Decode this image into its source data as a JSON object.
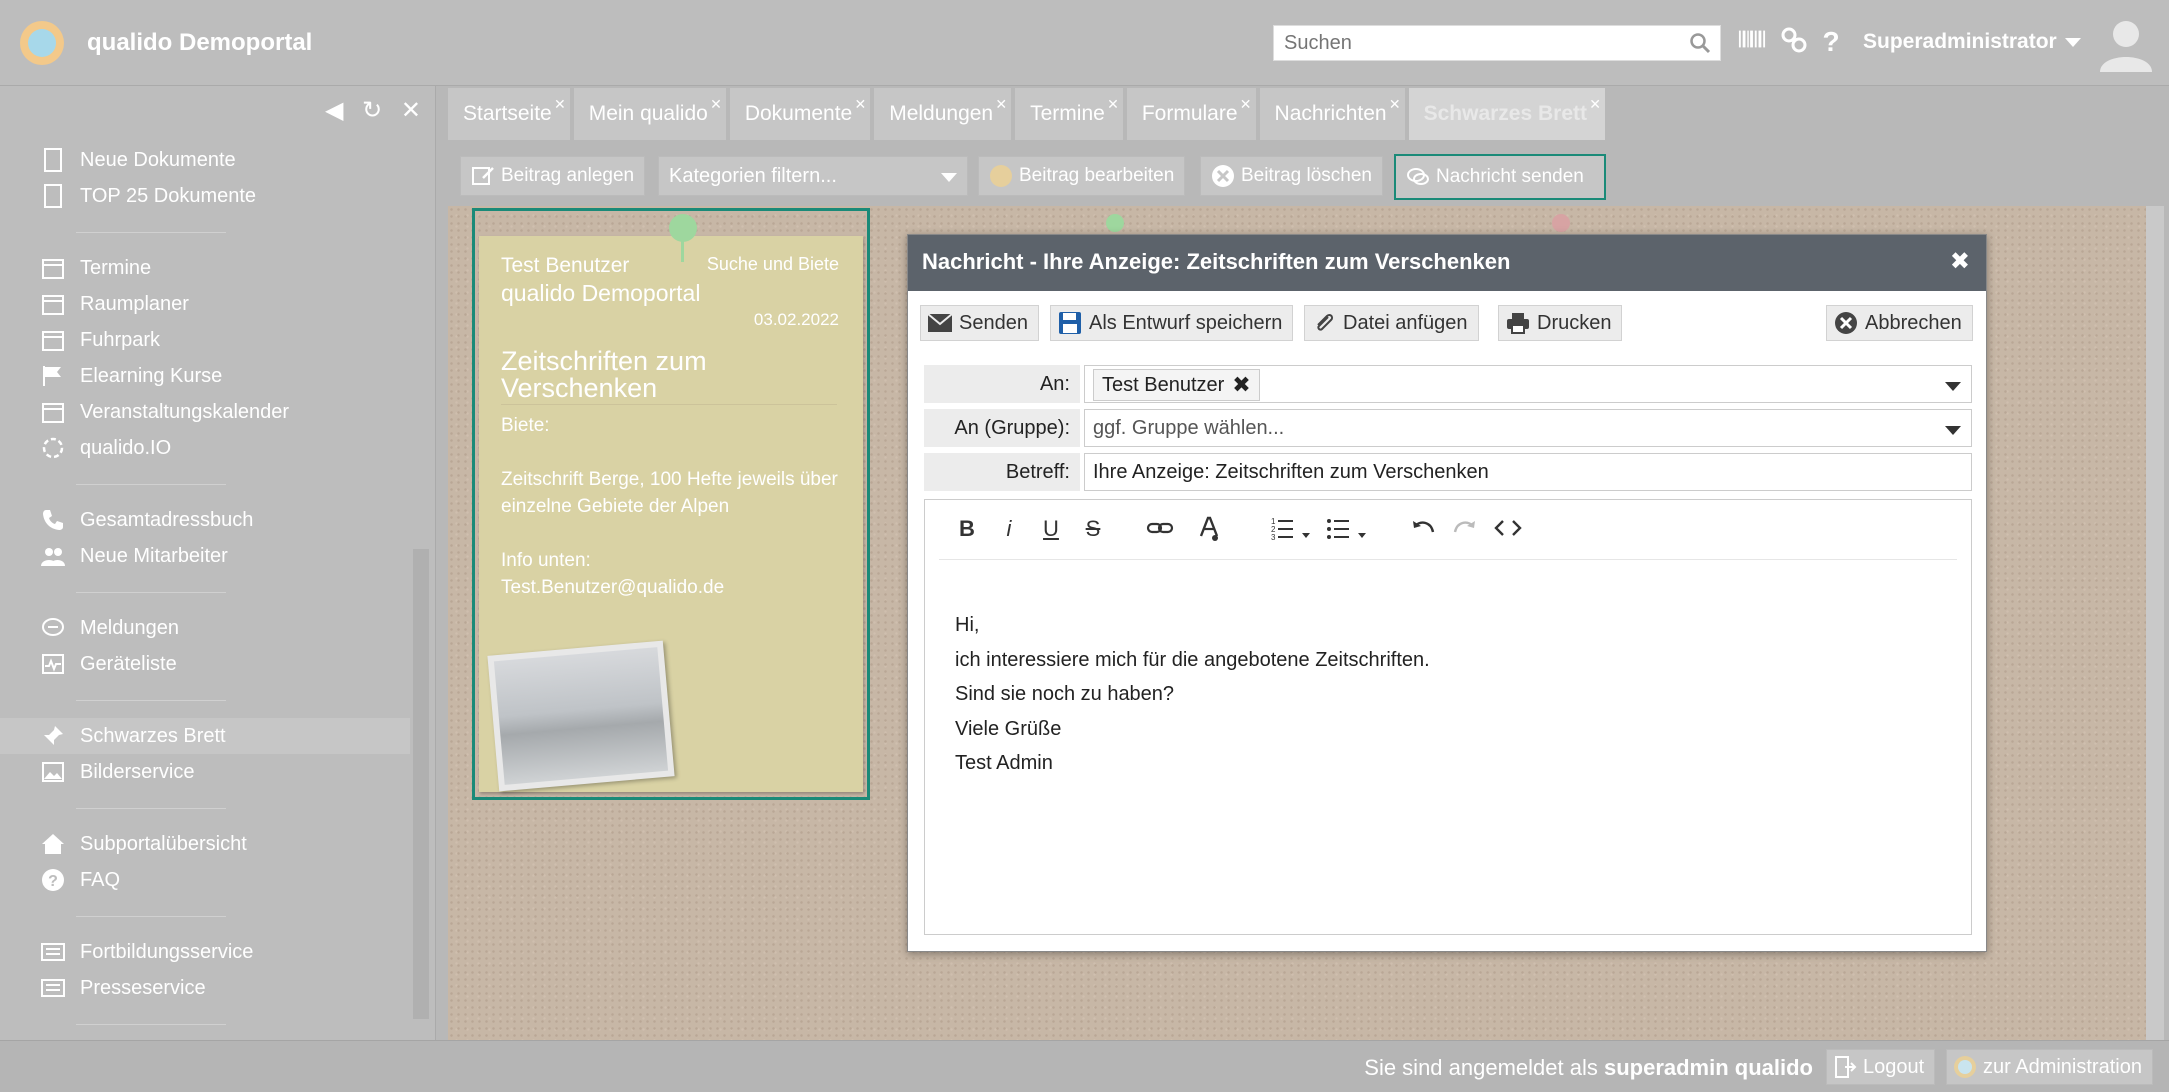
{
  "header": {
    "app_title": "qualido Demoportal",
    "search_placeholder": "Suchen",
    "user_name": "Superadministrator",
    "icons": [
      "barcode-icon",
      "gears-icon",
      "help-icon"
    ]
  },
  "sidebar": {
    "items": [
      {
        "label": "Neue Dokumente",
        "icon": "document-icon"
      },
      {
        "label": "TOP 25 Dokumente",
        "icon": "document-icon"
      },
      {
        "label": "Termine",
        "icon": "calendar-icon"
      },
      {
        "label": "Raumplaner",
        "icon": "calendar-icon"
      },
      {
        "label": "Fuhrpark",
        "icon": "calendar-icon"
      },
      {
        "label": "Elearning Kurse",
        "icon": "flag-icon"
      },
      {
        "label": "Veranstaltungskalender",
        "icon": "calendar-icon"
      },
      {
        "label": "qualido.IO",
        "icon": "circle-icon"
      },
      {
        "label": "Gesamtadressbuch",
        "icon": "phone-icon"
      },
      {
        "label": "Neue Mitarbeiter",
        "icon": "users-icon"
      },
      {
        "label": "Meldungen",
        "icon": "chat-icon"
      },
      {
        "label": "Geräteliste",
        "icon": "device-icon"
      },
      {
        "label": "Schwarzes Brett",
        "icon": "pin-icon",
        "active": true
      },
      {
        "label": "Bilderservice",
        "icon": "image-icon"
      },
      {
        "label": "Subportalübersicht",
        "icon": "home-icon"
      },
      {
        "label": "FAQ",
        "icon": "question-icon"
      },
      {
        "label": "Fortbildungsservice",
        "icon": "newspaper-icon"
      },
      {
        "label": "Presseservice",
        "icon": "newspaper-icon"
      }
    ]
  },
  "tabs": [
    {
      "label": "Startseite"
    },
    {
      "label": "Mein qualido"
    },
    {
      "label": "Dokumente"
    },
    {
      "label": "Meldungen"
    },
    {
      "label": "Termine"
    },
    {
      "label": "Formulare"
    },
    {
      "label": "Nachrichten"
    },
    {
      "label": "Schwarzes Brett",
      "active": true
    }
  ],
  "toolbar": {
    "add_post": "Beitrag anlegen",
    "filter_placeholder": "Kategorien filtern...",
    "edit_post": "Beitrag bearbeiten",
    "delete_post": "Beitrag löschen",
    "send_message": "Nachricht senden"
  },
  "note": {
    "author": "Test Benutzer",
    "portal": "qualido Demoportal",
    "category": "Suche und Biete",
    "date": "03.02.2022",
    "title": "Zeitschriften zum Verschenken",
    "body": "Biete:\n\nZeitschrift Berge, 100 Hefte jeweils über einzelne Gebiete der Alpen\n\nInfo unten:\nTest.Benutzer@qualido.de"
  },
  "dialog": {
    "title": "Nachricht - Ihre Anzeige: Zeitschriften zum Verschenken",
    "buttons": {
      "send": "Senden",
      "save_draft": "Als Entwurf speichern",
      "attach": "Datei anfügen",
      "print": "Drucken",
      "cancel": "Abbrechen"
    },
    "fields": {
      "to_label": "An:",
      "to_value": "Test Benutzer",
      "group_label": "An (Gruppe):",
      "group_placeholder": "ggf. Gruppe wählen...",
      "subject_label": "Betreff:",
      "subject_value": "Ihre Anzeige: Zeitschriften zum Verschenken"
    },
    "editor_toolbar": [
      "B",
      "i",
      "U",
      "S",
      "link",
      "color",
      "ordered-list",
      "bullet-list",
      "undo",
      "redo",
      "code"
    ],
    "message_body": "Hi,\nich interessiere mich für die angebotene Zeitschriften.\nSind sie noch zu haben?\nViele Grüße\nTest Admin"
  },
  "footer": {
    "logged_in_prefix": "Sie sind angemeldet als ",
    "logged_in_user": "superadmin qualido",
    "logout": "Logout",
    "admin": "zur Administration"
  },
  "colors": {
    "highlight": "#1a8a78",
    "dialog_header": "#5c636b",
    "overlay_gray": "#bdbdbd"
  }
}
